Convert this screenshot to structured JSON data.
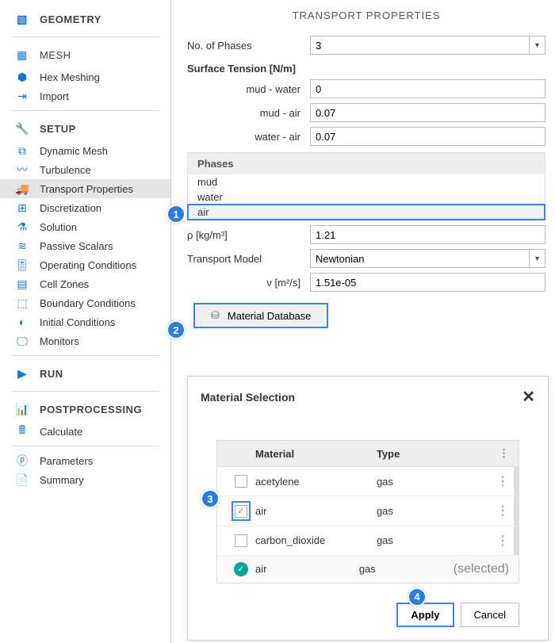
{
  "sidebar": {
    "sections": [
      {
        "label": "GEOMETRY",
        "items": []
      },
      {
        "label": "MESH",
        "items": [
          "Hex Meshing",
          "Import"
        ],
        "standalone": true
      },
      {
        "label": "SETUP",
        "items": [
          "Dynamic Mesh",
          "Turbulence",
          "Transport Properties",
          "Discretization",
          "Solution",
          "Passive Scalars",
          "Operating Conditions",
          "Cell Zones",
          "Boundary Conditions",
          "Initial Conditions",
          "Monitors"
        ]
      },
      {
        "label": "RUN",
        "items": []
      },
      {
        "label": "POSTPROCESSING",
        "items": [
          "Calculate"
        ]
      },
      {
        "label": "",
        "items": [
          "Parameters",
          "Summary"
        ],
        "noheader": true
      }
    ],
    "active": "Transport Properties"
  },
  "panel": {
    "title": "TRANSPORT PROPERTIES",
    "no_phases_label": "No. of Phases",
    "no_phases_value": "3",
    "surface_tension_label": "Surface Tension [N/m]",
    "tension": [
      {
        "label": "mud - water",
        "value": "0"
      },
      {
        "label": "mud - air",
        "value": "0.07"
      },
      {
        "label": "water - air",
        "value": "0.07"
      }
    ],
    "phases_header": "Phases",
    "phases": [
      "mud",
      "water",
      "air"
    ],
    "phases_selected": "air",
    "rho_label": "ρ [kg/m³]",
    "rho_value": "1.21",
    "tm_label": "Transport Model",
    "tm_value": "Newtonian",
    "nu_label": "ν [m²/s]",
    "nu_value": "1.51e-05",
    "mat_db_btn": "Material Database"
  },
  "dialog": {
    "title": "Material Selection",
    "col_material": "Material",
    "col_type": "Type",
    "rows": [
      {
        "name": "acetylene",
        "type": "gas",
        "checked": false
      },
      {
        "name": "air",
        "type": "gas",
        "checked": true
      },
      {
        "name": "carbon_dioxide",
        "type": "gas",
        "checked": false
      }
    ],
    "selected": {
      "name": "air",
      "type": "gas",
      "tag": "(selected)"
    },
    "apply": "Apply",
    "cancel": "Cancel"
  },
  "callouts": [
    "1",
    "2",
    "3",
    "4"
  ]
}
